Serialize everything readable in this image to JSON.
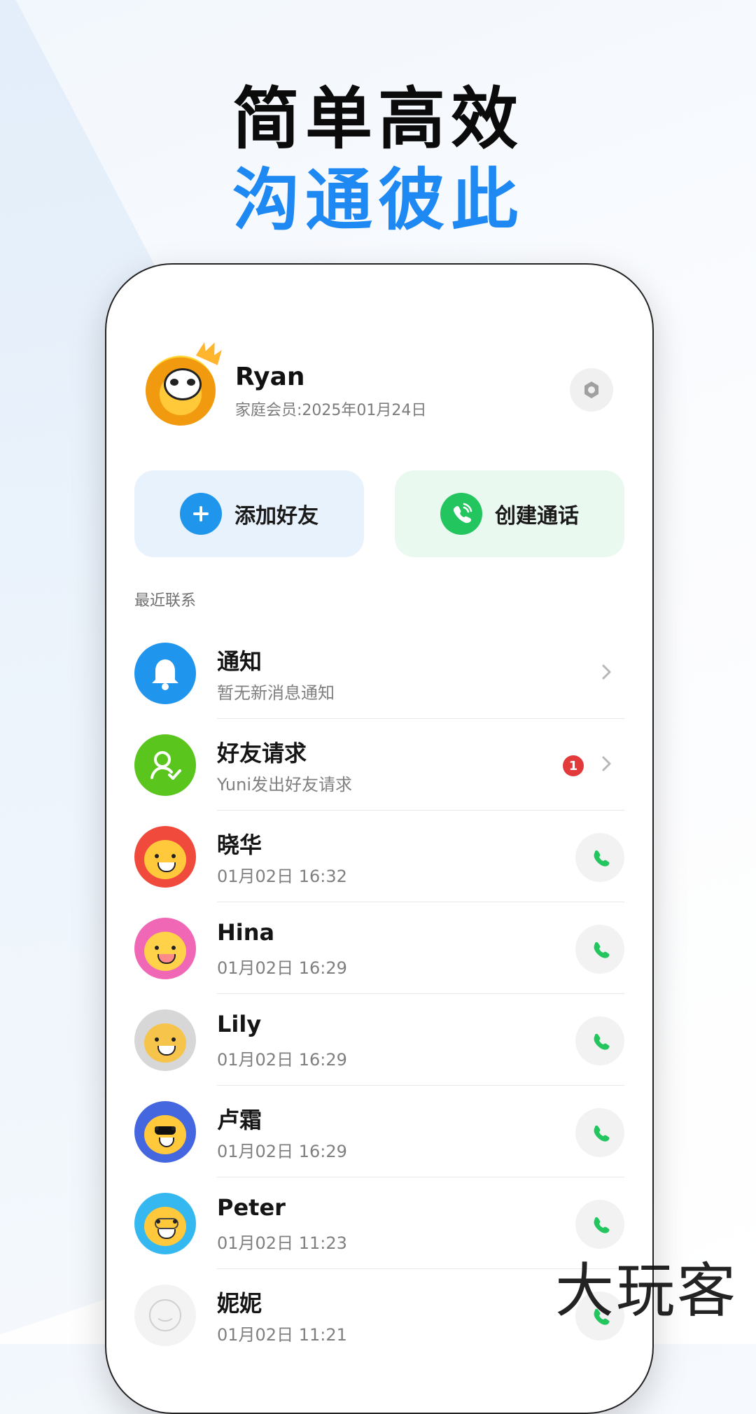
{
  "headline": {
    "line1": "简单高效",
    "line2": "沟通彼此"
  },
  "profile": {
    "name": "Ryan",
    "membership": "家庭会员:2025年01月24日"
  },
  "actions": {
    "add_friend": "添加好友",
    "create_call": "创建通话"
  },
  "recent": {
    "title": "最近联系",
    "items": [
      {
        "title": "通知",
        "subtitle": "暂无新消息通知",
        "icon": "bell-icon",
        "accent": "#1f95ee"
      },
      {
        "title": "好友请求",
        "subtitle": "Yuni发出好友请求",
        "icon": "friend-request-icon",
        "accent": "#59c51d",
        "badge": "1"
      },
      {
        "title": "晓华",
        "subtitle": "01月02日 16:32",
        "accent": "#ef4a3b"
      },
      {
        "title": "Hina",
        "subtitle": "01月02日 16:29",
        "accent": "#ef67b5"
      },
      {
        "title": "Lily",
        "subtitle": "01月02日 16:29",
        "accent": "#bdbdbd"
      },
      {
        "title": "卢霜",
        "subtitle": "01月02日 16:29",
        "accent": "#4467df"
      },
      {
        "title": "Peter",
        "subtitle": "01月02日 11:23",
        "accent": "#35b8ef"
      },
      {
        "title": "妮妮",
        "subtitle": "01月02日 11:21",
        "accent": "#f3f3f3"
      }
    ]
  },
  "watermark": "大玩客",
  "colors": {
    "blue": "#1e88f3",
    "green": "#22c55e",
    "red": "#e23a3a"
  }
}
